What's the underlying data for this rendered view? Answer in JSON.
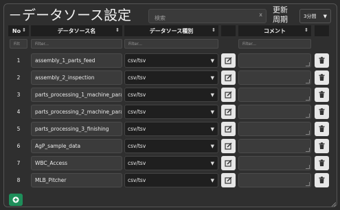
{
  "page": {
    "title": "－データソース設定",
    "search_placeholder": "検索",
    "search_clear": "x",
    "refresh_label": "更新\n周期",
    "refresh_line1": "更新",
    "refresh_line2": "周期",
    "refresh_interval": "3分間"
  },
  "table": {
    "headers": {
      "no": "No",
      "name": "データソース名",
      "type": "データソース種別",
      "comment": "コメント"
    },
    "filters": {
      "no": "Filt",
      "name": "Filter...",
      "type": "Filter...",
      "comment": "Filter..."
    },
    "rows": [
      {
        "no": "1",
        "name": "assembly_1_parts_feed",
        "type": "csv/tsv",
        "comment": ""
      },
      {
        "no": "2",
        "name": "assembly_2_inspection",
        "type": "csv/tsv",
        "comment": ""
      },
      {
        "no": "3",
        "name": "parts_processing_1_machine_para",
        "type": "csv/tsv",
        "comment": ""
      },
      {
        "no": "4",
        "name": "parts_processing_2_machine_para",
        "type": "csv/tsv",
        "comment": ""
      },
      {
        "no": "5",
        "name": "parts_processing_3_finishing",
        "type": "csv/tsv",
        "comment": ""
      },
      {
        "no": "6",
        "name": "AgP_sample_data",
        "type": "csv/tsv",
        "comment": ""
      },
      {
        "no": "7",
        "name": "WBC_Access",
        "type": "csv/tsv",
        "comment": ""
      },
      {
        "no": "8",
        "name": "MLB_Pitcher",
        "type": "csv/tsv",
        "comment": ""
      }
    ]
  },
  "icons": {
    "sort": "sort-updown-icon",
    "edit": "edit-square-icon",
    "delete": "trash-icon",
    "add": "plus-circle-icon",
    "dropdown": "chevron-down-icon"
  },
  "colors": {
    "background": "#2b2b2b",
    "header_bg": "#1f1f1f",
    "cell_bg": "#3b3b3b",
    "button_bg": "#e7e7e7",
    "add_button": "#1e8e5a"
  }
}
